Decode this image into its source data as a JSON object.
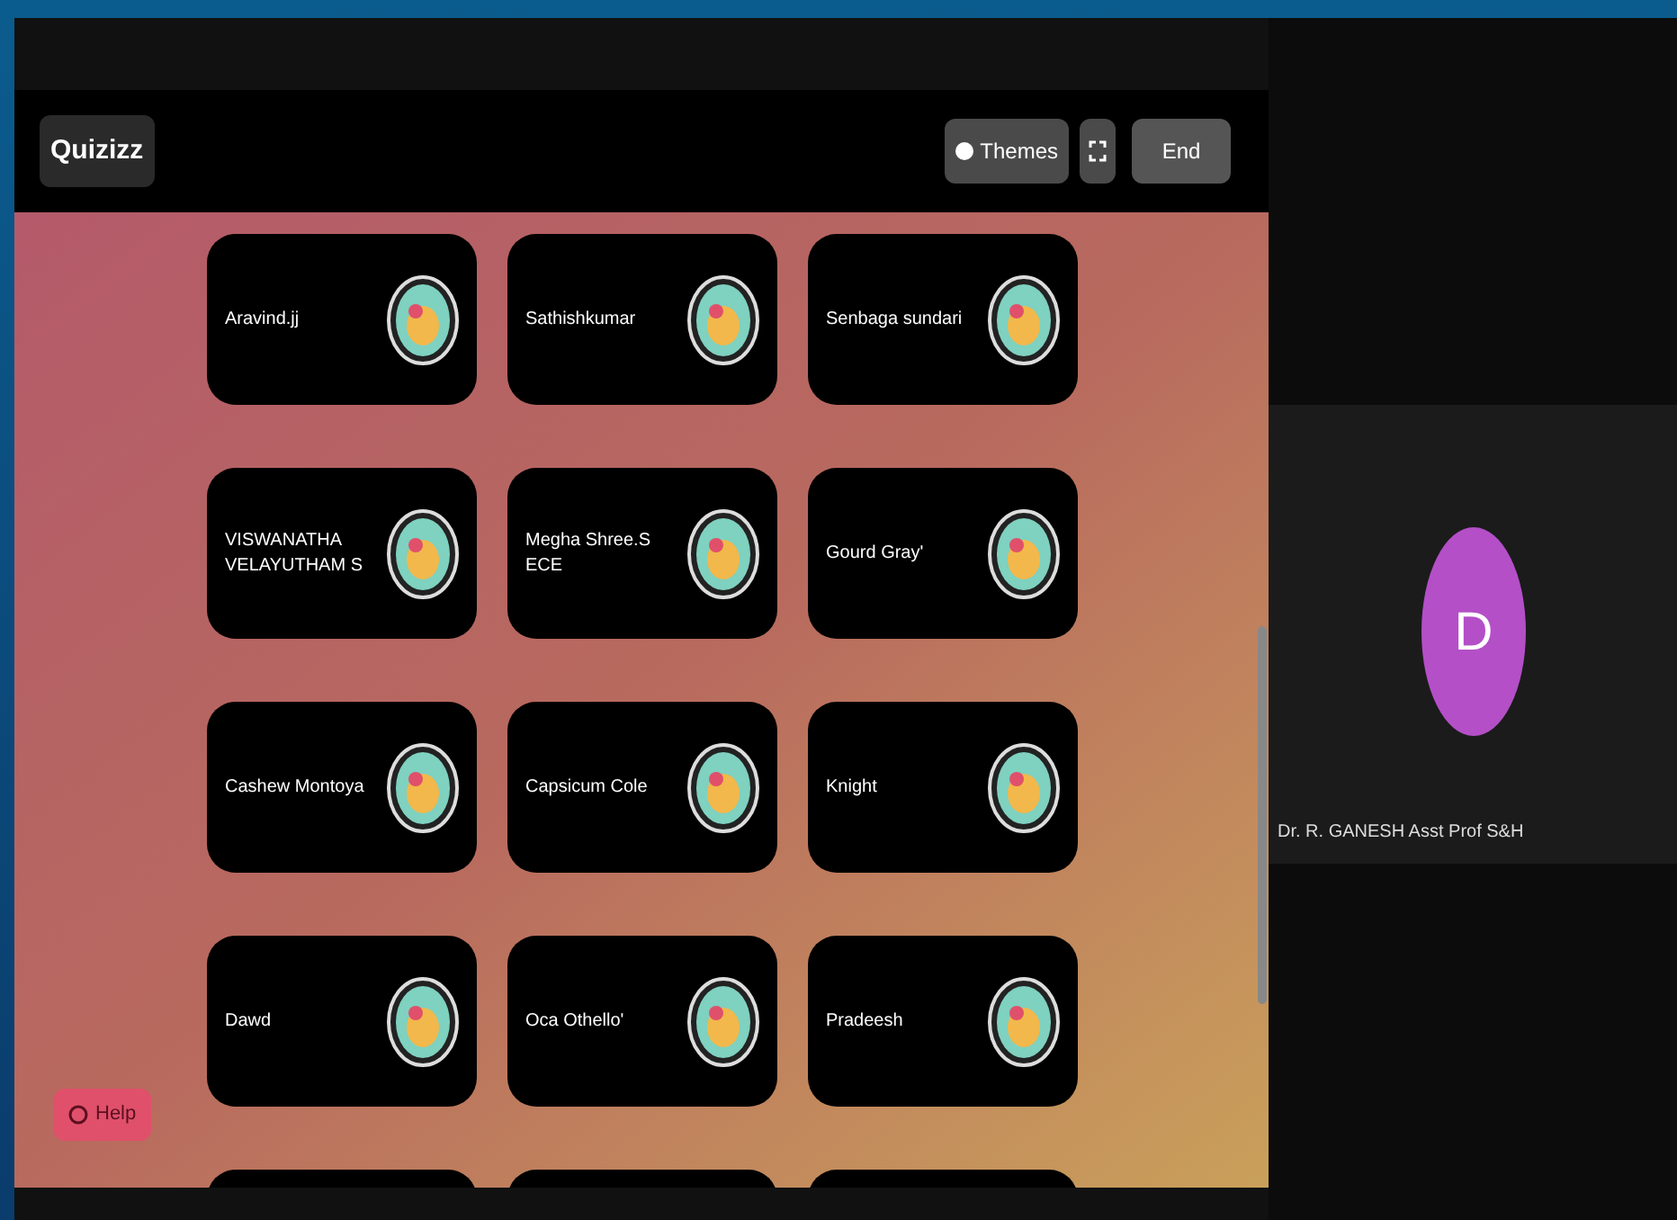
{
  "header": {
    "logo": "Quizizz",
    "buttons": [
      {
        "kind": "themes",
        "label": "Themes"
      },
      {
        "kind": "fullscreen"
      },
      {
        "kind": "end",
        "label": "End"
      }
    ]
  },
  "players": [
    {
      "name": "Aravind.jj"
    },
    {
      "name": "Sathishkumar"
    },
    {
      "name": "Senbaga sundari"
    },
    {
      "name": "VISWANATHA VELAYUTHAM S"
    },
    {
      "name": "Megha Shree.S ECE"
    },
    {
      "name": "Gourd Gray'"
    },
    {
      "name": "Cashew Montoya"
    },
    {
      "name": "Capsicum Cole"
    },
    {
      "name": "Knight"
    },
    {
      "name": "Dawd"
    },
    {
      "name": "Oca Othello'"
    },
    {
      "name": "Pradeesh"
    }
  ],
  "help_button": {
    "label": "Help"
  },
  "participant": {
    "initial": "D",
    "name": "Dr. R. GANESH Asst Prof S&H",
    "color": "#b44fc8"
  }
}
